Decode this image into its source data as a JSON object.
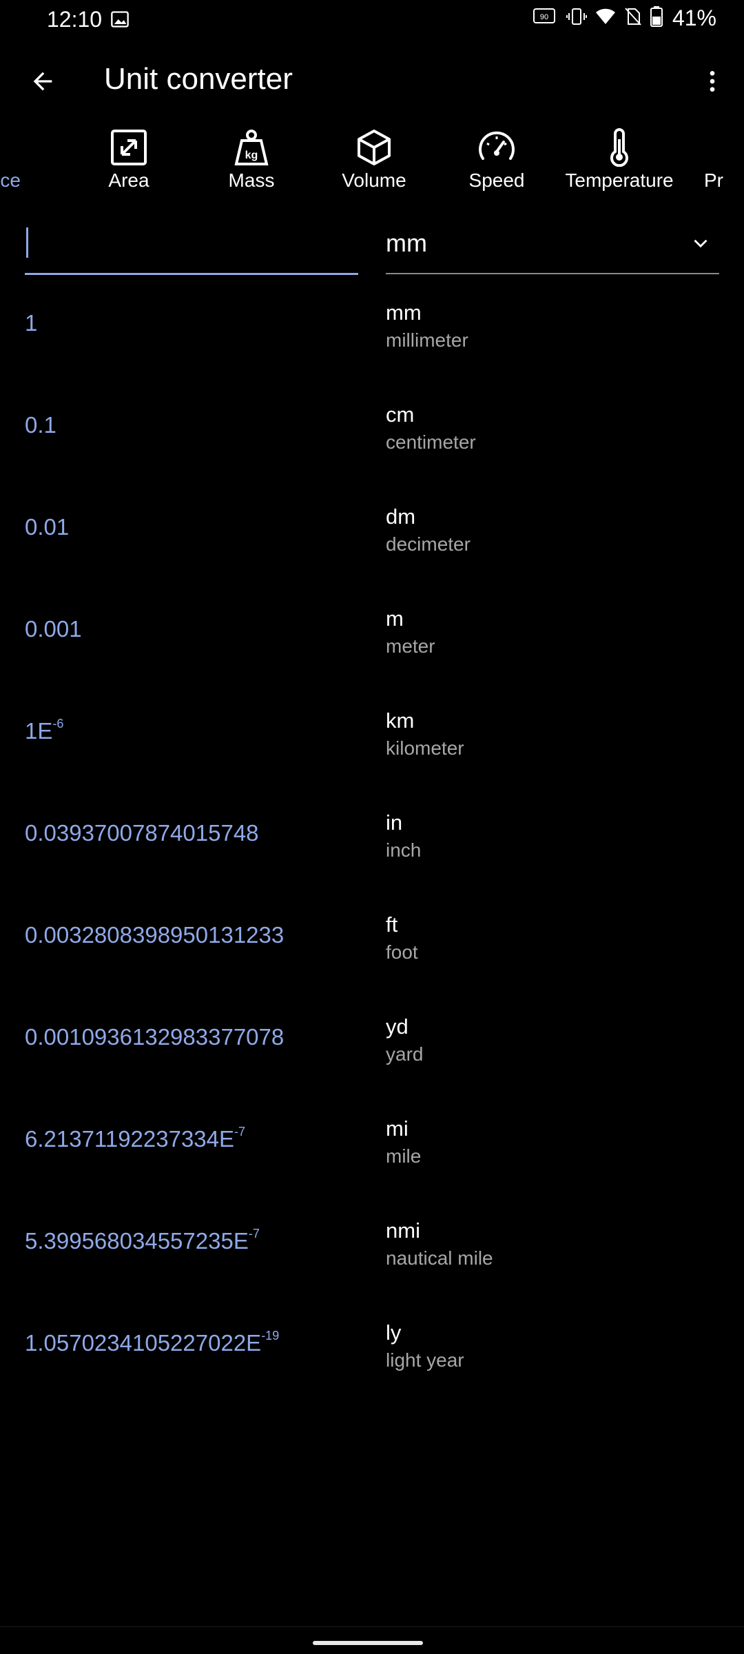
{
  "status_bar": {
    "time": "12:10",
    "battery_text": "41%"
  },
  "app_bar": {
    "title": "Unit converter"
  },
  "categories": [
    {
      "label": "ce",
      "icon": "length-icon"
    },
    {
      "label": "Area",
      "icon": "area-icon"
    },
    {
      "label": "Mass",
      "icon": "mass-icon"
    },
    {
      "label": "Volume",
      "icon": "volume-icon"
    },
    {
      "label": "Speed",
      "icon": "speed-icon"
    },
    {
      "label": "Temperature",
      "icon": "temperature-icon"
    },
    {
      "label": "Pr",
      "icon": "pressure-icon"
    }
  ],
  "input": {
    "value": "",
    "placeholder": ""
  },
  "unit_select": {
    "selected": "mm"
  },
  "results": [
    {
      "value": "1",
      "exp": "",
      "abbr": "mm",
      "name": "millimeter"
    },
    {
      "value": "0.1",
      "exp": "",
      "abbr": "cm",
      "name": "centimeter"
    },
    {
      "value": "0.01",
      "exp": "",
      "abbr": "dm",
      "name": "decimeter"
    },
    {
      "value": "0.001",
      "exp": "",
      "abbr": "m",
      "name": "meter"
    },
    {
      "value": "1E",
      "exp": "-6",
      "abbr": "km",
      "name": "kilometer"
    },
    {
      "value": "0.03937007874015748",
      "exp": "",
      "abbr": "in",
      "name": "inch"
    },
    {
      "value": "0.0032808398950131233",
      "exp": "",
      "abbr": "ft",
      "name": "foot"
    },
    {
      "value": "0.0010936132983377078",
      "exp": "",
      "abbr": "yd",
      "name": "yard"
    },
    {
      "value": "6.21371192237334E",
      "exp": "-7",
      "abbr": "mi",
      "name": "mile"
    },
    {
      "value": "5.399568034557235E",
      "exp": "-7",
      "abbr": "nmi",
      "name": "nautical mile"
    },
    {
      "value": "1.0570234105227022E",
      "exp": "-19",
      "abbr": "ly",
      "name": "light year"
    }
  ],
  "colors": {
    "accent": "#8fa9e8",
    "background": "#000000",
    "secondary_text": "#a7a7a7"
  }
}
